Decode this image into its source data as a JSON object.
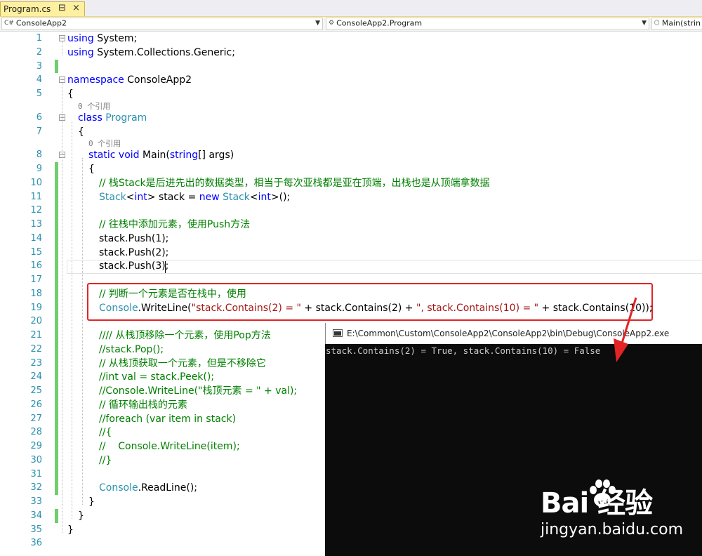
{
  "tab": {
    "title": "Program.cs",
    "pin": "⊟",
    "close": "×"
  },
  "navbar": {
    "project": "ConsoleApp2",
    "class": "ConsoleApp2.Program",
    "member": "Main(strin"
  },
  "lens_refs": "0 个引用",
  "lines": [
    {
      "n": "1",
      "indent": 0,
      "toks": [
        {
          "t": "kw",
          "v": "using"
        },
        {
          "t": "",
          "v": " System;"
        }
      ]
    },
    {
      "n": "2",
      "indent": 0,
      "toks": [
        {
          "t": "kw",
          "v": "using"
        },
        {
          "t": "",
          "v": " System.Collections.Generic;"
        }
      ]
    },
    {
      "n": "3",
      "indent": 0,
      "toks": []
    },
    {
      "n": "4",
      "indent": 0,
      "toks": [
        {
          "t": "kw",
          "v": "namespace"
        },
        {
          "t": "",
          "v": " ConsoleApp2"
        }
      ]
    },
    {
      "n": "5",
      "indent": 0,
      "toks": [
        {
          "t": "",
          "v": "{"
        }
      ]
    },
    {
      "n": "6",
      "indent": 1,
      "toks": [
        {
          "t": "kw",
          "v": "class"
        },
        {
          "t": "",
          "v": " "
        },
        {
          "t": "ty",
          "v": "Program"
        }
      ]
    },
    {
      "n": "7",
      "indent": 1,
      "toks": [
        {
          "t": "",
          "v": "{"
        }
      ]
    },
    {
      "n": "8",
      "indent": 2,
      "toks": [
        {
          "t": "kw",
          "v": "static"
        },
        {
          "t": "",
          "v": " "
        },
        {
          "t": "kw",
          "v": "void"
        },
        {
          "t": "",
          "v": " Main("
        },
        {
          "t": "kw",
          "v": "string"
        },
        {
          "t": "",
          "v": "[] args)"
        }
      ]
    },
    {
      "n": "9",
      "indent": 2,
      "toks": [
        {
          "t": "",
          "v": "{"
        }
      ]
    },
    {
      "n": "10",
      "indent": 3,
      "toks": [
        {
          "t": "cm",
          "v": "// 栈Stack是后进先出的数据类型，相当于每次亚栈都是亚在顶端，出栈也是从顶端拿数据"
        }
      ]
    },
    {
      "n": "11",
      "indent": 3,
      "toks": [
        {
          "t": "ty",
          "v": "Stack"
        },
        {
          "t": "",
          "v": "<"
        },
        {
          "t": "kw",
          "v": "int"
        },
        {
          "t": "",
          "v": "> stack = "
        },
        {
          "t": "kw",
          "v": "new"
        },
        {
          "t": "",
          "v": " "
        },
        {
          "t": "ty",
          "v": "Stack"
        },
        {
          "t": "",
          "v": "<"
        },
        {
          "t": "kw",
          "v": "int"
        },
        {
          "t": "",
          "v": ">();"
        }
      ]
    },
    {
      "n": "12",
      "indent": 3,
      "toks": []
    },
    {
      "n": "13",
      "indent": 3,
      "toks": [
        {
          "t": "cm",
          "v": "// 往栈中添加元素，使用Push方法"
        }
      ]
    },
    {
      "n": "14",
      "indent": 3,
      "toks": [
        {
          "t": "",
          "v": "stack.Push(1);"
        }
      ]
    },
    {
      "n": "15",
      "indent": 3,
      "toks": [
        {
          "t": "",
          "v": "stack.Push(2);"
        }
      ]
    },
    {
      "n": "16",
      "indent": 3,
      "toks": [
        {
          "t": "",
          "v": "stack.Push(3);"
        }
      ]
    },
    {
      "n": "17",
      "indent": 3,
      "toks": []
    },
    {
      "n": "18",
      "indent": 3,
      "toks": [
        {
          "t": "cm",
          "v": "// 判断一个元素是否在栈中，使用"
        }
      ]
    },
    {
      "n": "19",
      "indent": 3,
      "toks": [
        {
          "t": "ty",
          "v": "Console"
        },
        {
          "t": "",
          "v": ".WriteLine("
        },
        {
          "t": "st",
          "v": "\"stack.Contains(2) = \""
        },
        {
          "t": "",
          "v": " + stack.Contains(2) + "
        },
        {
          "t": "st",
          "v": "\", stack.Contains(10) = \""
        },
        {
          "t": "",
          "v": " + stack.Contains(10));"
        }
      ]
    },
    {
      "n": "20",
      "indent": 3,
      "toks": []
    },
    {
      "n": "21",
      "indent": 3,
      "toks": [
        {
          "t": "cm",
          "v": "//// 从栈顶移除一个元素，使用Pop方法"
        }
      ]
    },
    {
      "n": "22",
      "indent": 3,
      "toks": [
        {
          "t": "cm",
          "v": "//stack.Pop();"
        }
      ]
    },
    {
      "n": "23",
      "indent": 3,
      "toks": [
        {
          "t": "cm",
          "v": "// 从栈顶获取一个元素，但是不移除它"
        }
      ]
    },
    {
      "n": "24",
      "indent": 3,
      "toks": [
        {
          "t": "cm",
          "v": "//int val = stack.Peek();"
        }
      ]
    },
    {
      "n": "25",
      "indent": 3,
      "toks": [
        {
          "t": "cm",
          "v": "//Console.WriteLine(\"栈顶元素 = \" + val);"
        }
      ]
    },
    {
      "n": "26",
      "indent": 3,
      "toks": [
        {
          "t": "cm",
          "v": "// 循环输出栈的元素"
        }
      ]
    },
    {
      "n": "27",
      "indent": 3,
      "toks": [
        {
          "t": "cm",
          "v": "//foreach (var item in stack)"
        }
      ]
    },
    {
      "n": "28",
      "indent": 3,
      "toks": [
        {
          "t": "cm",
          "v": "//{"
        }
      ]
    },
    {
      "n": "29",
      "indent": 3,
      "toks": [
        {
          "t": "cm",
          "v": "//    Console.WriteLine(item);"
        }
      ]
    },
    {
      "n": "30",
      "indent": 3,
      "toks": [
        {
          "t": "cm",
          "v": "//}"
        }
      ]
    },
    {
      "n": "31",
      "indent": 3,
      "toks": []
    },
    {
      "n": "32",
      "indent": 3,
      "toks": [
        {
          "t": "ty",
          "v": "Console"
        },
        {
          "t": "",
          "v": ".ReadLine();"
        }
      ]
    },
    {
      "n": "33",
      "indent": 2,
      "toks": [
        {
          "t": "",
          "v": "}"
        }
      ]
    },
    {
      "n": "34",
      "indent": 1,
      "toks": [
        {
          "t": "",
          "v": "}"
        }
      ]
    },
    {
      "n": "35",
      "indent": 0,
      "toks": [
        {
          "t": "",
          "v": "}"
        }
      ]
    },
    {
      "n": "36",
      "indent": 0,
      "toks": []
    }
  ],
  "console": {
    "title": "E:\\Common\\Custom\\ConsoleApp2\\ConsoleApp2\\bin\\Debug\\ConsoleApp2.exe",
    "output": "stack.Contains(2) = True, stack.Contains(10) = False"
  },
  "watermark": {
    "logo": "Bai  经验",
    "url": "jingyan.baidu.com"
  },
  "colors": {
    "keyword": "#0000ff",
    "type": "#2b91af",
    "comment": "#008000",
    "string": "#a31515",
    "highlight": "#e22424"
  }
}
